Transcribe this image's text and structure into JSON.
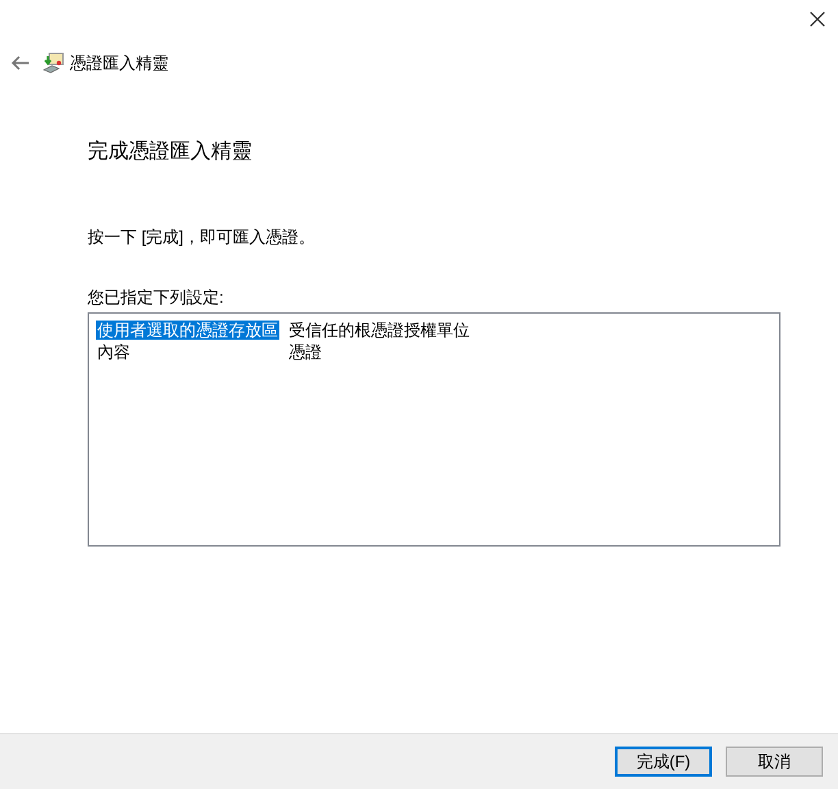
{
  "window": {
    "title": "憑證匯入精靈"
  },
  "heading": "完成憑證匯入精靈",
  "instruction": "按一下 [完成]，即可匯入憑證。",
  "settings_label": "您已指定下列設定:",
  "settings": [
    {
      "name": "使用者選取的憑證存放區",
      "value": "受信任的根憑證授權單位",
      "selected": true
    },
    {
      "name": "內容",
      "value": "憑證",
      "selected": false
    }
  ],
  "buttons": [
    {
      "label": "完成(F)",
      "default": true
    },
    {
      "label": "取消",
      "default": false
    }
  ]
}
